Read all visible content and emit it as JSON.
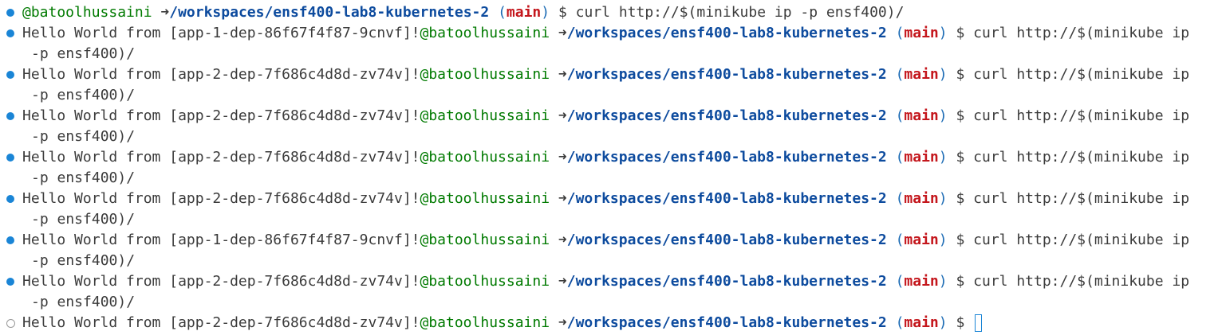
{
  "prompt": {
    "user": "@batoolhussaini",
    "arrow": "➜",
    "path": "/workspaces/ensf400-lab8-kubernetes-2",
    "branch": "main",
    "symbol": "$"
  },
  "command": {
    "first_line": "curl http://$(minikube ip -p ensf400)/",
    "wrap_line1": "curl http://$(minikube ip",
    "wrap_line2": "-p ensf400)/"
  },
  "status_colors": {
    "completed": "#1a85d6",
    "pending": "#9a9a9a"
  },
  "entries": [
    {
      "status": "completed",
      "output": "",
      "command_part1": "curl http://$(minikube ip -p ensf400)/"
    },
    {
      "status": "completed",
      "output": "Hello World from [app-1-dep-86f67f4f87-9cnvf]!",
      "command_part1": "curl http://$(minikube ip",
      "command_part2": "-p ensf400)/"
    },
    {
      "status": "completed",
      "output": "Hello World from [app-2-dep-7f686c4d8d-zv74v]!",
      "command_part1": "curl http://$(minikube ip",
      "command_part2": "-p ensf400)/"
    },
    {
      "status": "completed",
      "output": "Hello World from [app-2-dep-7f686c4d8d-zv74v]!",
      "command_part1": "curl http://$(minikube ip",
      "command_part2": "-p ensf400)/"
    },
    {
      "status": "completed",
      "output": "Hello World from [app-2-dep-7f686c4d8d-zv74v]!",
      "command_part1": "curl http://$(minikube ip",
      "command_part2": "-p ensf400)/"
    },
    {
      "status": "completed",
      "output": "Hello World from [app-2-dep-7f686c4d8d-zv74v]!",
      "command_part1": "curl http://$(minikube ip",
      "command_part2": "-p ensf400)/"
    },
    {
      "status": "completed",
      "output": "Hello World from [app-1-dep-86f67f4f87-9cnvf]!",
      "command_part1": "curl http://$(minikube ip",
      "command_part2": "-p ensf400)/"
    },
    {
      "status": "completed",
      "output": "Hello World from [app-2-dep-7f686c4d8d-zv74v]!",
      "command_part1": "curl http://$(minikube ip",
      "command_part2": "-p ensf400)/"
    },
    {
      "status": "pending",
      "output": "Hello World from [app-2-dep-7f686c4d8d-zv74v]!",
      "command_part1": ""
    }
  ]
}
